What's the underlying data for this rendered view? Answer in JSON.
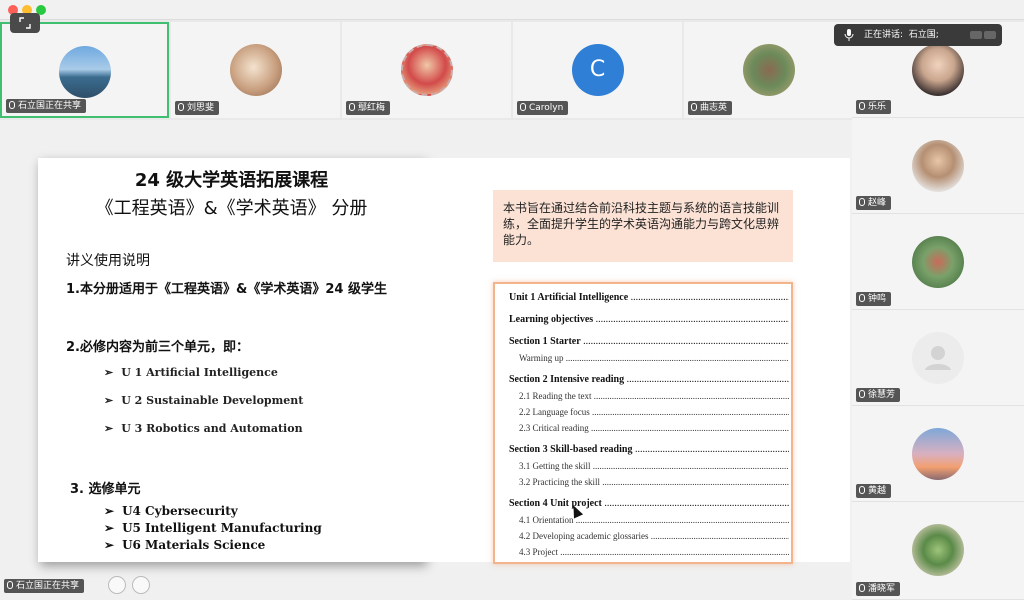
{
  "top_tiles": [
    {
      "name": "石立国正在共享",
      "active": true,
      "avatar": "lake-photo"
    },
    {
      "name": "刘思斐",
      "active": false,
      "avatar": "sketch-photo"
    },
    {
      "name": "鄢红梅",
      "active": false,
      "avatar": "portrait-stamp"
    },
    {
      "name": "Carolyn",
      "active": false,
      "avatar": "letter",
      "letter": "C"
    },
    {
      "name": "曲志英",
      "active": false,
      "avatar": "squirrel-photo"
    }
  ],
  "speaking": {
    "label": "正在讲话:",
    "speaker": "石立国;"
  },
  "right_tiles": [
    {
      "name": "乐乐",
      "avatar": "woman-glasses"
    },
    {
      "name": "赵峰",
      "avatar": "man-photo"
    },
    {
      "name": "钟鸣",
      "avatar": "succulent-photo"
    },
    {
      "name": "徐慧芳",
      "avatar": "default-person"
    },
    {
      "name": "黄越",
      "avatar": "tower-photo"
    },
    {
      "name": "潘晓军",
      "avatar": "plant-photo"
    }
  ],
  "slide": {
    "title_line1": "24  级大学英语拓展课程",
    "title_line2": "《工程英语》&《学术英语》  分册",
    "usage_heading": "讲义使用说明",
    "point1": "1.本分册适用于《工程英语》&《学术英语》24 级学生",
    "point2": "2.必修内容为前三个单元，即：",
    "required_units": [
      "U 1 Artificial Intelligence",
      "U 2 Sustainable Development",
      "U 3 Robotics and Automation"
    ],
    "point3": "3. 选修单元",
    "elective_units": [
      "U4 Cybersecurity",
      "U5 Intelligent Manufacturing",
      "U6 Materials Science"
    ],
    "intro_text": "本书旨在通过结合前沿科技主题与系统的语言技能训练，全面提升学生的学术英语沟通能力与跨文化思辨能力。",
    "toc": [
      {
        "text": "Unit 1 Artificial Intelligence",
        "level": "bold"
      },
      {
        "gap": true
      },
      {
        "text": "Learning objectives",
        "level": "bold"
      },
      {
        "gap": true
      },
      {
        "text": "Section 1 Starter",
        "level": "bold"
      },
      {
        "text": "Warming up",
        "level": "sub"
      },
      {
        "gap": true
      },
      {
        "text": "Section 2 Intensive reading",
        "level": "bold"
      },
      {
        "text": "2.1 Reading the text",
        "level": "sub"
      },
      {
        "text": "2.2 Language focus",
        "level": "sub"
      },
      {
        "text": "2.3 Critical reading",
        "level": "sub"
      },
      {
        "gap": true
      },
      {
        "text": "Section 3 Skill-based reading",
        "level": "bold"
      },
      {
        "text": "3.1 Getting the skill",
        "level": "sub"
      },
      {
        "text": "3.2 Practicing the skill",
        "level": "sub"
      },
      {
        "gap": true
      },
      {
        "text": "Section 4 Unit project",
        "level": "bold"
      },
      {
        "text": "4.1 Orientation",
        "level": "sub"
      },
      {
        "text": "4.2 Developing academic glossaries",
        "level": "sub"
      },
      {
        "text": "4.3 Project",
        "level": "sub"
      }
    ]
  },
  "bottom_tag": "石立国正在共享",
  "colors": {
    "active_border": "#3fbf6f",
    "intro_bg": "#fbe2d5",
    "toc_border": "#f2b48d",
    "letter_avatar": "#2f7fd6"
  }
}
